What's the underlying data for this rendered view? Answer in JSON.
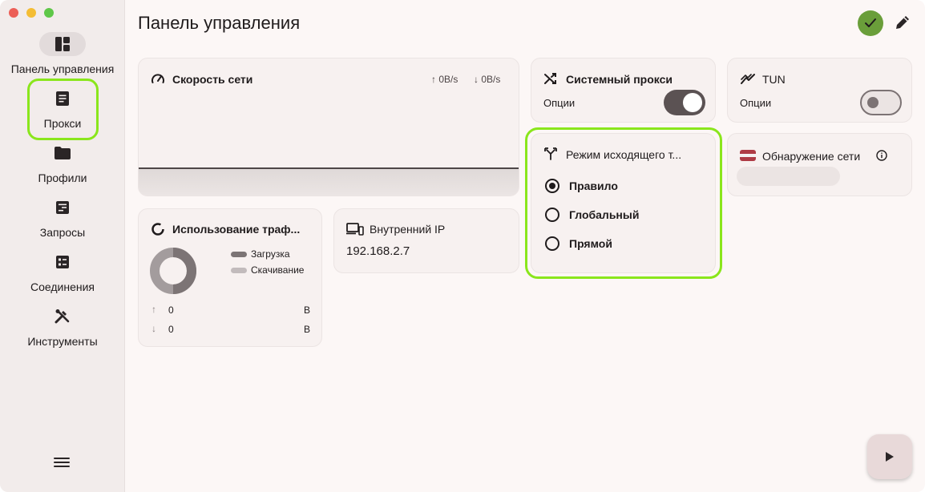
{
  "sidebar": {
    "items": [
      {
        "label": "Панель управления",
        "icon": "dashboard-icon",
        "active": true
      },
      {
        "label": "Прокси",
        "icon": "proxy-list-icon",
        "active": false
      },
      {
        "label": "Профили",
        "icon": "folder-icon",
        "active": false
      },
      {
        "label": "Запросы",
        "icon": "requests-icon",
        "active": false
      },
      {
        "label": "Соединения",
        "icon": "connections-icon",
        "active": false
      },
      {
        "label": "Инструменты",
        "icon": "tools-icon",
        "active": false
      }
    ]
  },
  "header": {
    "title": "Панель управления"
  },
  "speed": {
    "title": "Скорость сети",
    "upload": "↑ 0B/s",
    "download": "↓ 0B/s"
  },
  "traffic_usage": {
    "title": "Использование траф...",
    "legend_upload": "Загрузка",
    "legend_download": "Скачивание",
    "up_value": "0",
    "up_unit": "B",
    "down_value": "0",
    "down_unit": "B"
  },
  "internal_ip": {
    "title": "Внутренний IP",
    "value": "192.168.2.7"
  },
  "system_proxy": {
    "title": "Системный прокси",
    "options_label": "Опции",
    "enabled": true
  },
  "tun": {
    "title": "TUN",
    "options_label": "Опции",
    "enabled": false
  },
  "outbound_mode": {
    "title": "Режим исходящего т...",
    "options": [
      "Правило",
      "Глобальный",
      "Прямой"
    ],
    "selected": "Правило"
  },
  "network_detection": {
    "title": "Обнаружение сети"
  },
  "colors": {
    "highlight": "#8ae61c",
    "status_ok": "#6a9e3a",
    "toggle_on": "#5b5253",
    "background": "#fcf7f6"
  }
}
